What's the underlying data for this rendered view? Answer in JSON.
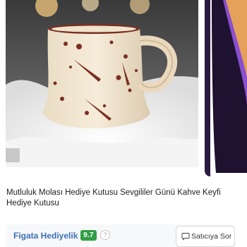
{
  "product": {
    "title": "Mutluluk Molası Hediye Kutusu Sevgililer Günü Kahve Keyfi Hediye Kutusu"
  },
  "seller": {
    "name": "Figata Hediyelik",
    "rating": "9.7",
    "info_glyph": "?",
    "ask_label": "Satıcıya Sor",
    "ask_icon": "chat-icon"
  },
  "colors": {
    "seller_name": "#3b6fb6",
    "rating_badge": "#2f9e44"
  }
}
